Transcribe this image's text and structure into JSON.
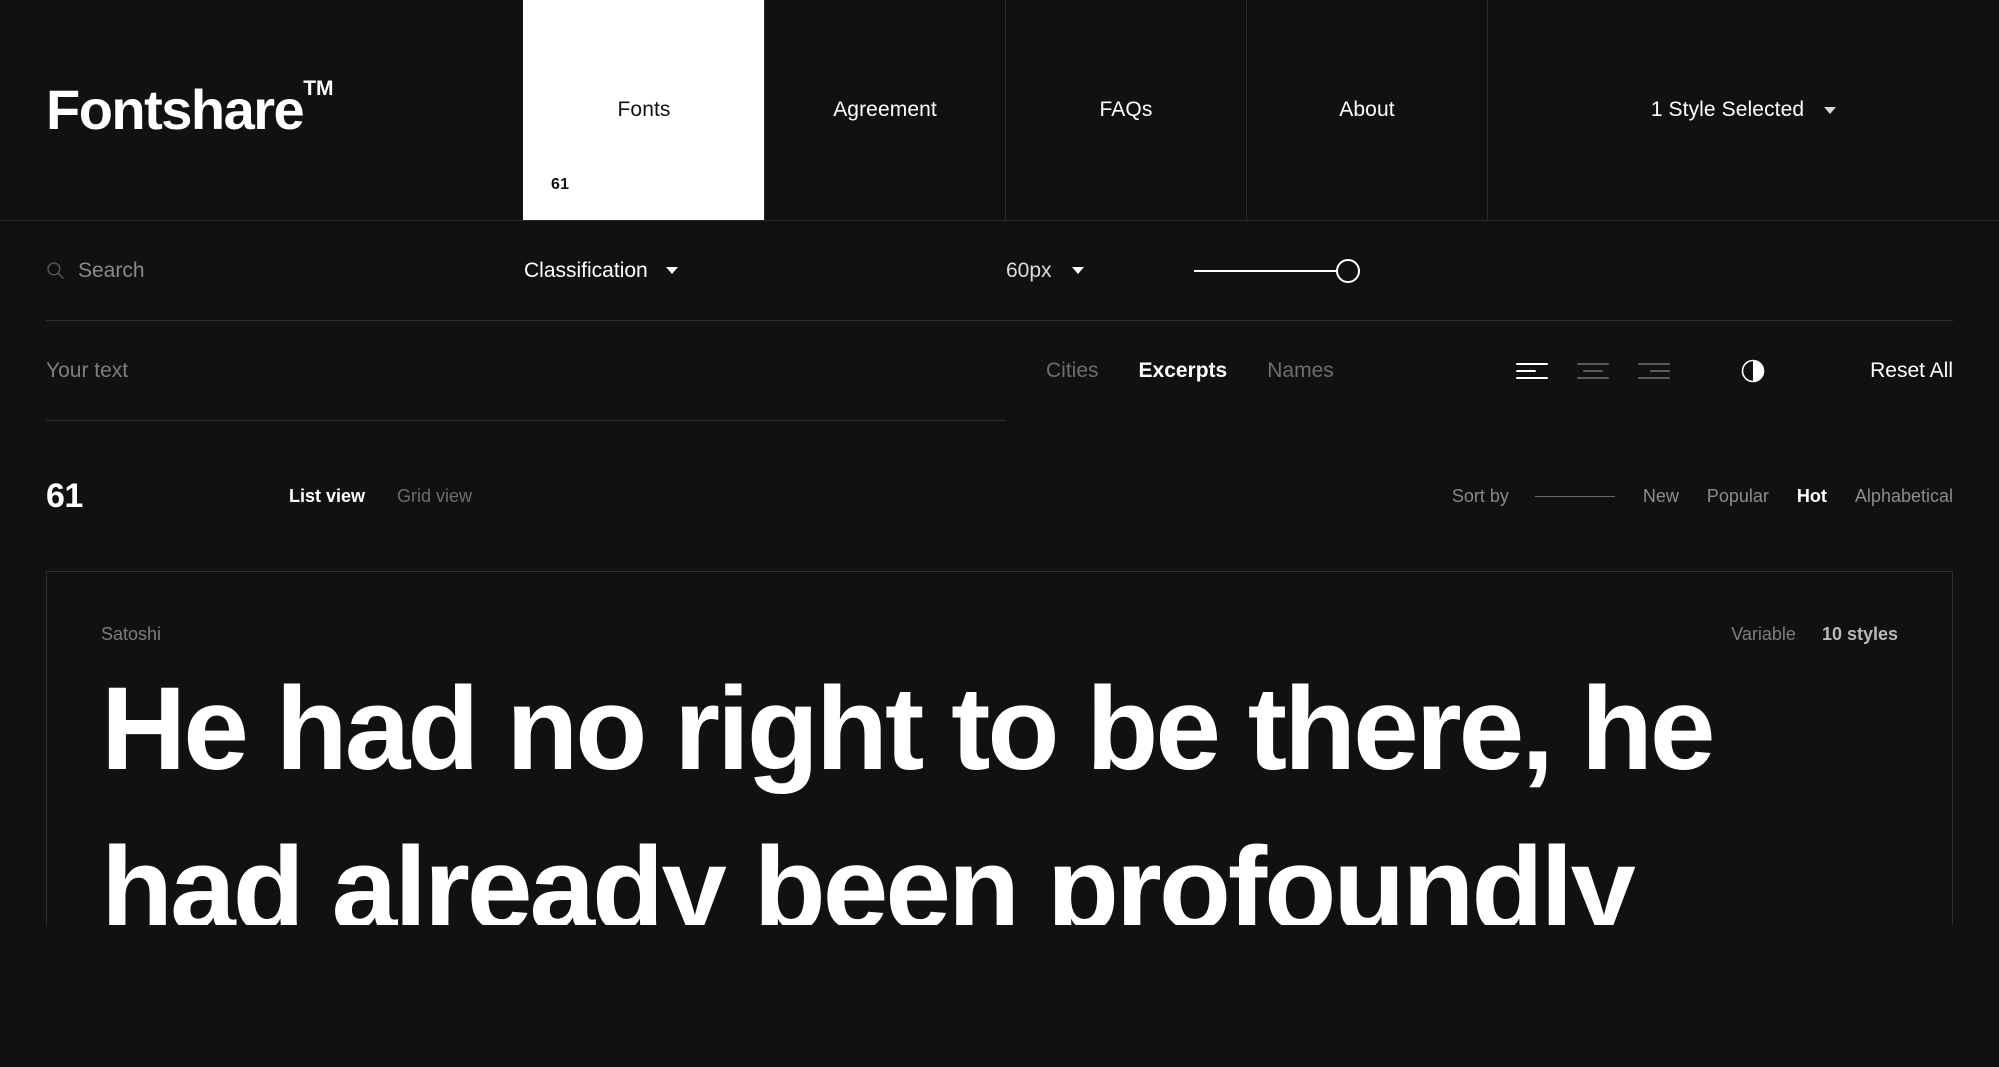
{
  "header": {
    "brand": "Fontshare",
    "brand_tm": "TM",
    "nav": [
      {
        "label": "Fonts",
        "count": "61",
        "active": true
      },
      {
        "label": "Agreement",
        "active": false
      },
      {
        "label": "FAQs",
        "active": false
      },
      {
        "label": "About",
        "active": false
      }
    ],
    "styles_selector": {
      "label": "1 Style Selected",
      "icon": "chevron-down-icon"
    }
  },
  "controls": {
    "search": {
      "placeholder": "Search",
      "value": "",
      "icon": "search-icon"
    },
    "classification": {
      "label": "Classification",
      "icon": "chevron-down-icon"
    },
    "size": {
      "label": "60px",
      "icon": "chevron-down-icon",
      "slider_value": 100
    },
    "custom_text": {
      "placeholder": "Your text",
      "value": ""
    },
    "preset_tabs": [
      {
        "label": "Cities",
        "active": false
      },
      {
        "label": "Excerpts",
        "active": true
      },
      {
        "label": "Names",
        "active": false
      }
    ],
    "alignment": [
      {
        "name": "align-left-icon",
        "active": true
      },
      {
        "name": "align-center-icon",
        "active": false
      },
      {
        "name": "align-right-icon",
        "active": false
      }
    ],
    "contrast_toggle": "contrast-icon",
    "reset_all": "Reset All"
  },
  "results": {
    "count": "61",
    "views": [
      {
        "label": "List view",
        "active": true
      },
      {
        "label": "Grid view",
        "active": false
      }
    ],
    "sort": {
      "label": "Sort by",
      "options": [
        {
          "label": "New",
          "active": false
        },
        {
          "label": "Popular",
          "active": false
        },
        {
          "label": "Hot",
          "active": true
        },
        {
          "label": "Alphabetical",
          "active": false
        }
      ]
    }
  },
  "font_cards": [
    {
      "name": "Satoshi",
      "variable": "Variable",
      "styles": "10 styles",
      "specimen": "He had no right to be there, he had already been profoundly"
    }
  ],
  "colors": {
    "background": "#111111",
    "foreground": "#ffffff",
    "muted": "#7d7d7d",
    "border": "#2f2f2f",
    "active_tab_bg": "#ffffff"
  }
}
